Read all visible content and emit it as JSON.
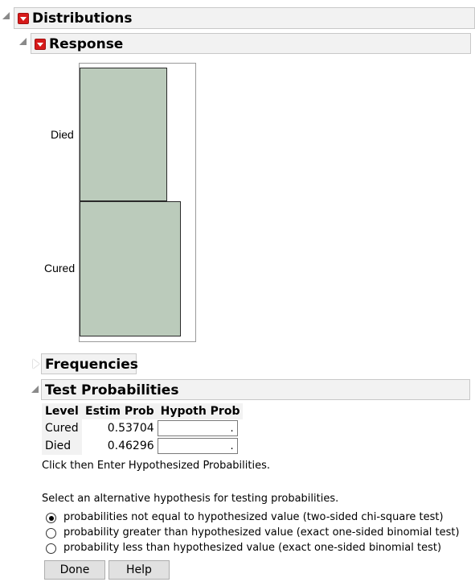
{
  "distributions": {
    "title": "Distributions"
  },
  "response": {
    "title": "Response",
    "chart_data": {
      "type": "bar",
      "orientation": "horizontal",
      "categories": [
        "Died",
        "Cured"
      ],
      "values": [
        0.46296,
        0.53704
      ]
    }
  },
  "frequencies": {
    "title": "Frequencies"
  },
  "test_probabilities": {
    "title": "Test Probabilities",
    "columns": [
      "Level",
      "Estim Prob",
      "Hypoth Prob"
    ],
    "rows": [
      {
        "level": "Cured",
        "estim": "0.53704",
        "hypoth": "."
      },
      {
        "level": "Died",
        "estim": "0.46296",
        "hypoth": "."
      }
    ],
    "instruction": "Click then Enter Hypothesized Probabilities.",
    "select_prompt": "Select an alternative hypothesis for testing probabilities.",
    "options": [
      {
        "label": "probabilities not equal to hypothesized value (two-sided chi-square test)",
        "selected": true
      },
      {
        "label": "probability greater than hypothesized value (exact one-sided binomial test)",
        "selected": false
      },
      {
        "label": "probability less than hypothesized value (exact one-sided binomial test)",
        "selected": false
      }
    ],
    "buttons": {
      "done": "Done",
      "help": "Help"
    }
  }
}
